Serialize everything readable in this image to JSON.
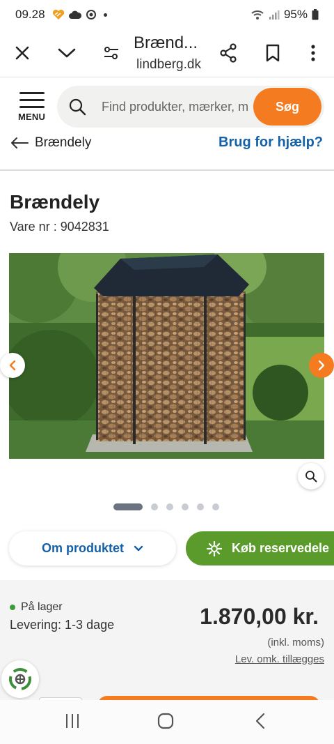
{
  "status_bar": {
    "time": "09.28",
    "battery": "95%"
  },
  "browser": {
    "title": "Brænd...",
    "url": "lindberg.dk"
  },
  "header": {
    "menu_label": "MENU",
    "search_placeholder": "Find produkter, mærker, m",
    "search_button": "Søg"
  },
  "breadcrumb": {
    "back_label": "Brændely",
    "help_link": "Brug for hjælp?"
  },
  "product": {
    "title": "Brændely",
    "item_number": "Vare nr : 9042831",
    "image_count": 6,
    "active_image": 1
  },
  "actions": {
    "about_label": "Om produktet",
    "reserve_label": "Køb reservedele"
  },
  "stock": {
    "status": "På lager",
    "delivery": "Levering: 1-3 dage"
  },
  "price": {
    "amount": "1.870,00 kr.",
    "vat_note": "(inkl. moms)",
    "shipping_note": "Lev. omk. tillægges"
  },
  "colors": {
    "accent_orange": "#f47b20",
    "link_blue": "#1561a8",
    "green": "#5b9b2c"
  }
}
